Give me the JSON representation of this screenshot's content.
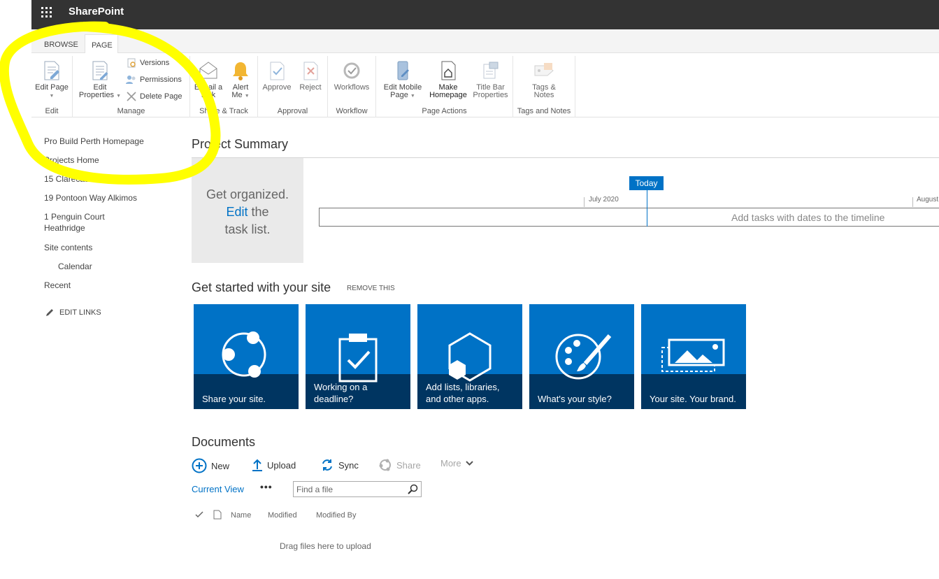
{
  "suite": {
    "brand": "SharePoint"
  },
  "ribbon": {
    "tabs": [
      {
        "label": "BROWSE"
      },
      {
        "label": "PAGE"
      }
    ],
    "edit": {
      "group": "Edit",
      "edit_page": "Edit Page"
    },
    "manage": {
      "group": "Manage",
      "edit_properties_1": "Edit",
      "edit_properties_2": "Properties",
      "versions": "Versions",
      "permissions": "Permissions",
      "delete_page": "Delete Page"
    },
    "share": {
      "group": "Share & Track",
      "email_1": "E-mail a",
      "email_2": "Link",
      "alert_1": "Alert",
      "alert_2": "Me"
    },
    "approval": {
      "group": "Approval",
      "approve": "Approve",
      "reject": "Reject"
    },
    "workflow": {
      "group": "Workflow",
      "workflows": "Workflows"
    },
    "page_actions": {
      "group": "Page Actions",
      "mobile_1": "Edit Mobile",
      "mobile_2": "Page",
      "homepage_1": "Make",
      "homepage_2": "Homepage",
      "titlebar_1": "Title Bar",
      "titlebar_2": "Properties"
    },
    "tags": {
      "group": "Tags and Notes",
      "tags_1": "Tags &",
      "tags_2": "Notes"
    }
  },
  "leftnav": {
    "items": [
      {
        "label": "Pro Build Perth Homepage"
      },
      {
        "label": "Projects Home"
      },
      {
        "label": "15 Clarecastle Retreat"
      },
      {
        "label": "19 Pontoon Way Alkimos"
      },
      {
        "label": "1 Penguin Court Heathridge"
      },
      {
        "label": "Site contents"
      },
      {
        "label": "Calendar"
      },
      {
        "label": "Recent"
      }
    ],
    "edit_links": "EDIT LINKS"
  },
  "project_summary": {
    "title": "Project Summary",
    "organized_1": "Get organized.",
    "organized_link": "Edit",
    "organized_2": " the",
    "organized_3": "task list.",
    "today": "Today",
    "month_1": "July 2020",
    "month_2": "August",
    "timeline_placeholder": "Add tasks with dates to the timeline"
  },
  "get_started": {
    "title": "Get started with your site",
    "remove": "REMOVE THIS",
    "tiles": [
      {
        "label": "Share your site.",
        "icon": "share-icon"
      },
      {
        "label": "Working on a deadline?",
        "icon": "clipboard-check-icon"
      },
      {
        "label": "Add lists, libraries, and other apps.",
        "icon": "apps-hexagon-icon"
      },
      {
        "label": "What's your style?",
        "icon": "palette-icon"
      },
      {
        "label": "Your site. Your brand.",
        "icon": "picture-icon"
      }
    ]
  },
  "documents": {
    "title": "Documents",
    "commands": {
      "new": "New",
      "upload": "Upload",
      "sync": "Sync",
      "share": "Share",
      "more": "More"
    },
    "current_view": "Current View",
    "ellipsis": "•••",
    "search_placeholder": "Find a file",
    "columns": {
      "name": "Name",
      "modified": "Modified",
      "modified_by": "Modified By"
    },
    "drag_text": "Drag files here to upload"
  },
  "colors": {
    "accent": "#0072c6",
    "tile_band": "#003561",
    "suite_bar": "#333333",
    "highlight": "#ffff00"
  }
}
